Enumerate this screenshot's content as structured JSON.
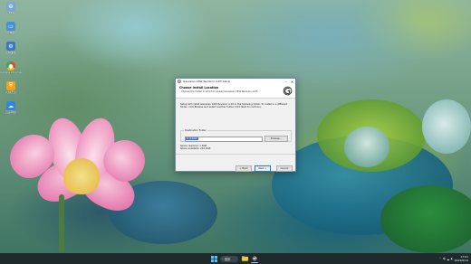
{
  "desktop": {
    "icons": [
      {
        "label": "回收站",
        "icon": "recycle-bin-icon",
        "color": "#7aa7d6"
      },
      {
        "label": "此电脑",
        "icon": "this-pc-icon",
        "color": "#4a90d9"
      },
      {
        "label": "控制面板",
        "icon": "control-panel-icon",
        "color": "#3c78c8"
      },
      {
        "label": "Google Chrome",
        "icon": "chrome-icon",
        "color": "#e94235"
      },
      {
        "label": "火绒安全",
        "icon": "security-shield-icon",
        "color": "#f2a31a"
      },
      {
        "label": "百度网盘",
        "icon": "baidu-cloud-icon",
        "color": "#2f86e6"
      }
    ]
  },
  "installer": {
    "title": "Gaussian 16W Revision A.03 Setup",
    "header_title": "Choose Install Location",
    "header_subtitle": "Choose the folder in which to install Gaussian 16W Revision A.03.",
    "description": "Setup will install Gaussian 16W Revision A.03 in the following folder. To install in a different folder, click Browse and select another folder. Click Next to continue.",
    "destination_legend": "Destination Folder",
    "destination_value": "D:\\G16W",
    "browse_label": "Browse...",
    "space_required": "Space required: 1.5GB",
    "space_available": "Space available: 242.0GB",
    "back_label": "< Back",
    "next_label": "Next >",
    "cancel_label": "Cancel"
  },
  "taskbar": {
    "search_label": "搜索",
    "time": "17:01",
    "date": "2024/6/14",
    "lang": "中",
    "accent": "#2a73c8"
  }
}
